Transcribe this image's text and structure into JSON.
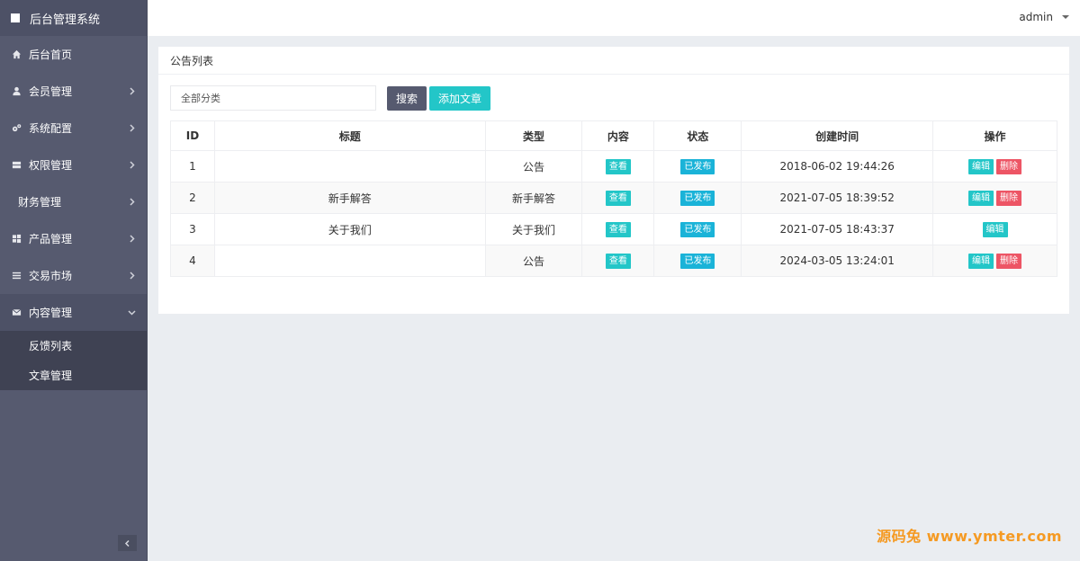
{
  "app": {
    "title": "后台管理系统"
  },
  "sidebar": {
    "items": [
      {
        "label": "后台首页",
        "icon": "home-icon"
      },
      {
        "label": "会员管理",
        "icon": "user-icon"
      },
      {
        "label": "系统配置",
        "icon": "cogs-icon"
      },
      {
        "label": "权限管理",
        "icon": "server-icon"
      },
      {
        "label": "财务管理",
        "icon": ""
      },
      {
        "label": "产品管理",
        "icon": "windows-icon"
      },
      {
        "label": "交易市场",
        "icon": "list-icon"
      },
      {
        "label": "内容管理",
        "icon": "envelope-icon"
      }
    ],
    "subitems": [
      {
        "label": "反馈列表"
      },
      {
        "label": "文章管理"
      }
    ]
  },
  "header": {
    "user": "admin"
  },
  "panel": {
    "title": "公告列表",
    "filter_value": "全部分类",
    "search_label": "搜索",
    "add_label": "添加文章"
  },
  "table": {
    "headers": [
      "ID",
      "标题",
      "类型",
      "内容",
      "状态",
      "创建时间",
      "操作"
    ],
    "view_label": "查看",
    "status_label": "已发布",
    "edit_label": "编辑",
    "delete_label": "删除",
    "rows": [
      {
        "id": "1",
        "title": "",
        "type": "公告",
        "created": "2018-06-02 19:44:26"
      },
      {
        "id": "2",
        "title": "新手解答",
        "type": "新手解答",
        "created": "2021-07-05 18:39:52"
      },
      {
        "id": "3",
        "title": "关于我们",
        "type": "关于我们",
        "created": "2021-07-05 18:43:37"
      },
      {
        "id": "4",
        "title": "",
        "type": "公告",
        "created": "2024-03-05 13:24:01"
      }
    ]
  },
  "watermark": "源码兔 www.ymter.com",
  "colors": {
    "sidebar": "#565a6f",
    "accent": "#23c6c8",
    "danger": "#ed5565",
    "info": "#1ab3d8"
  }
}
